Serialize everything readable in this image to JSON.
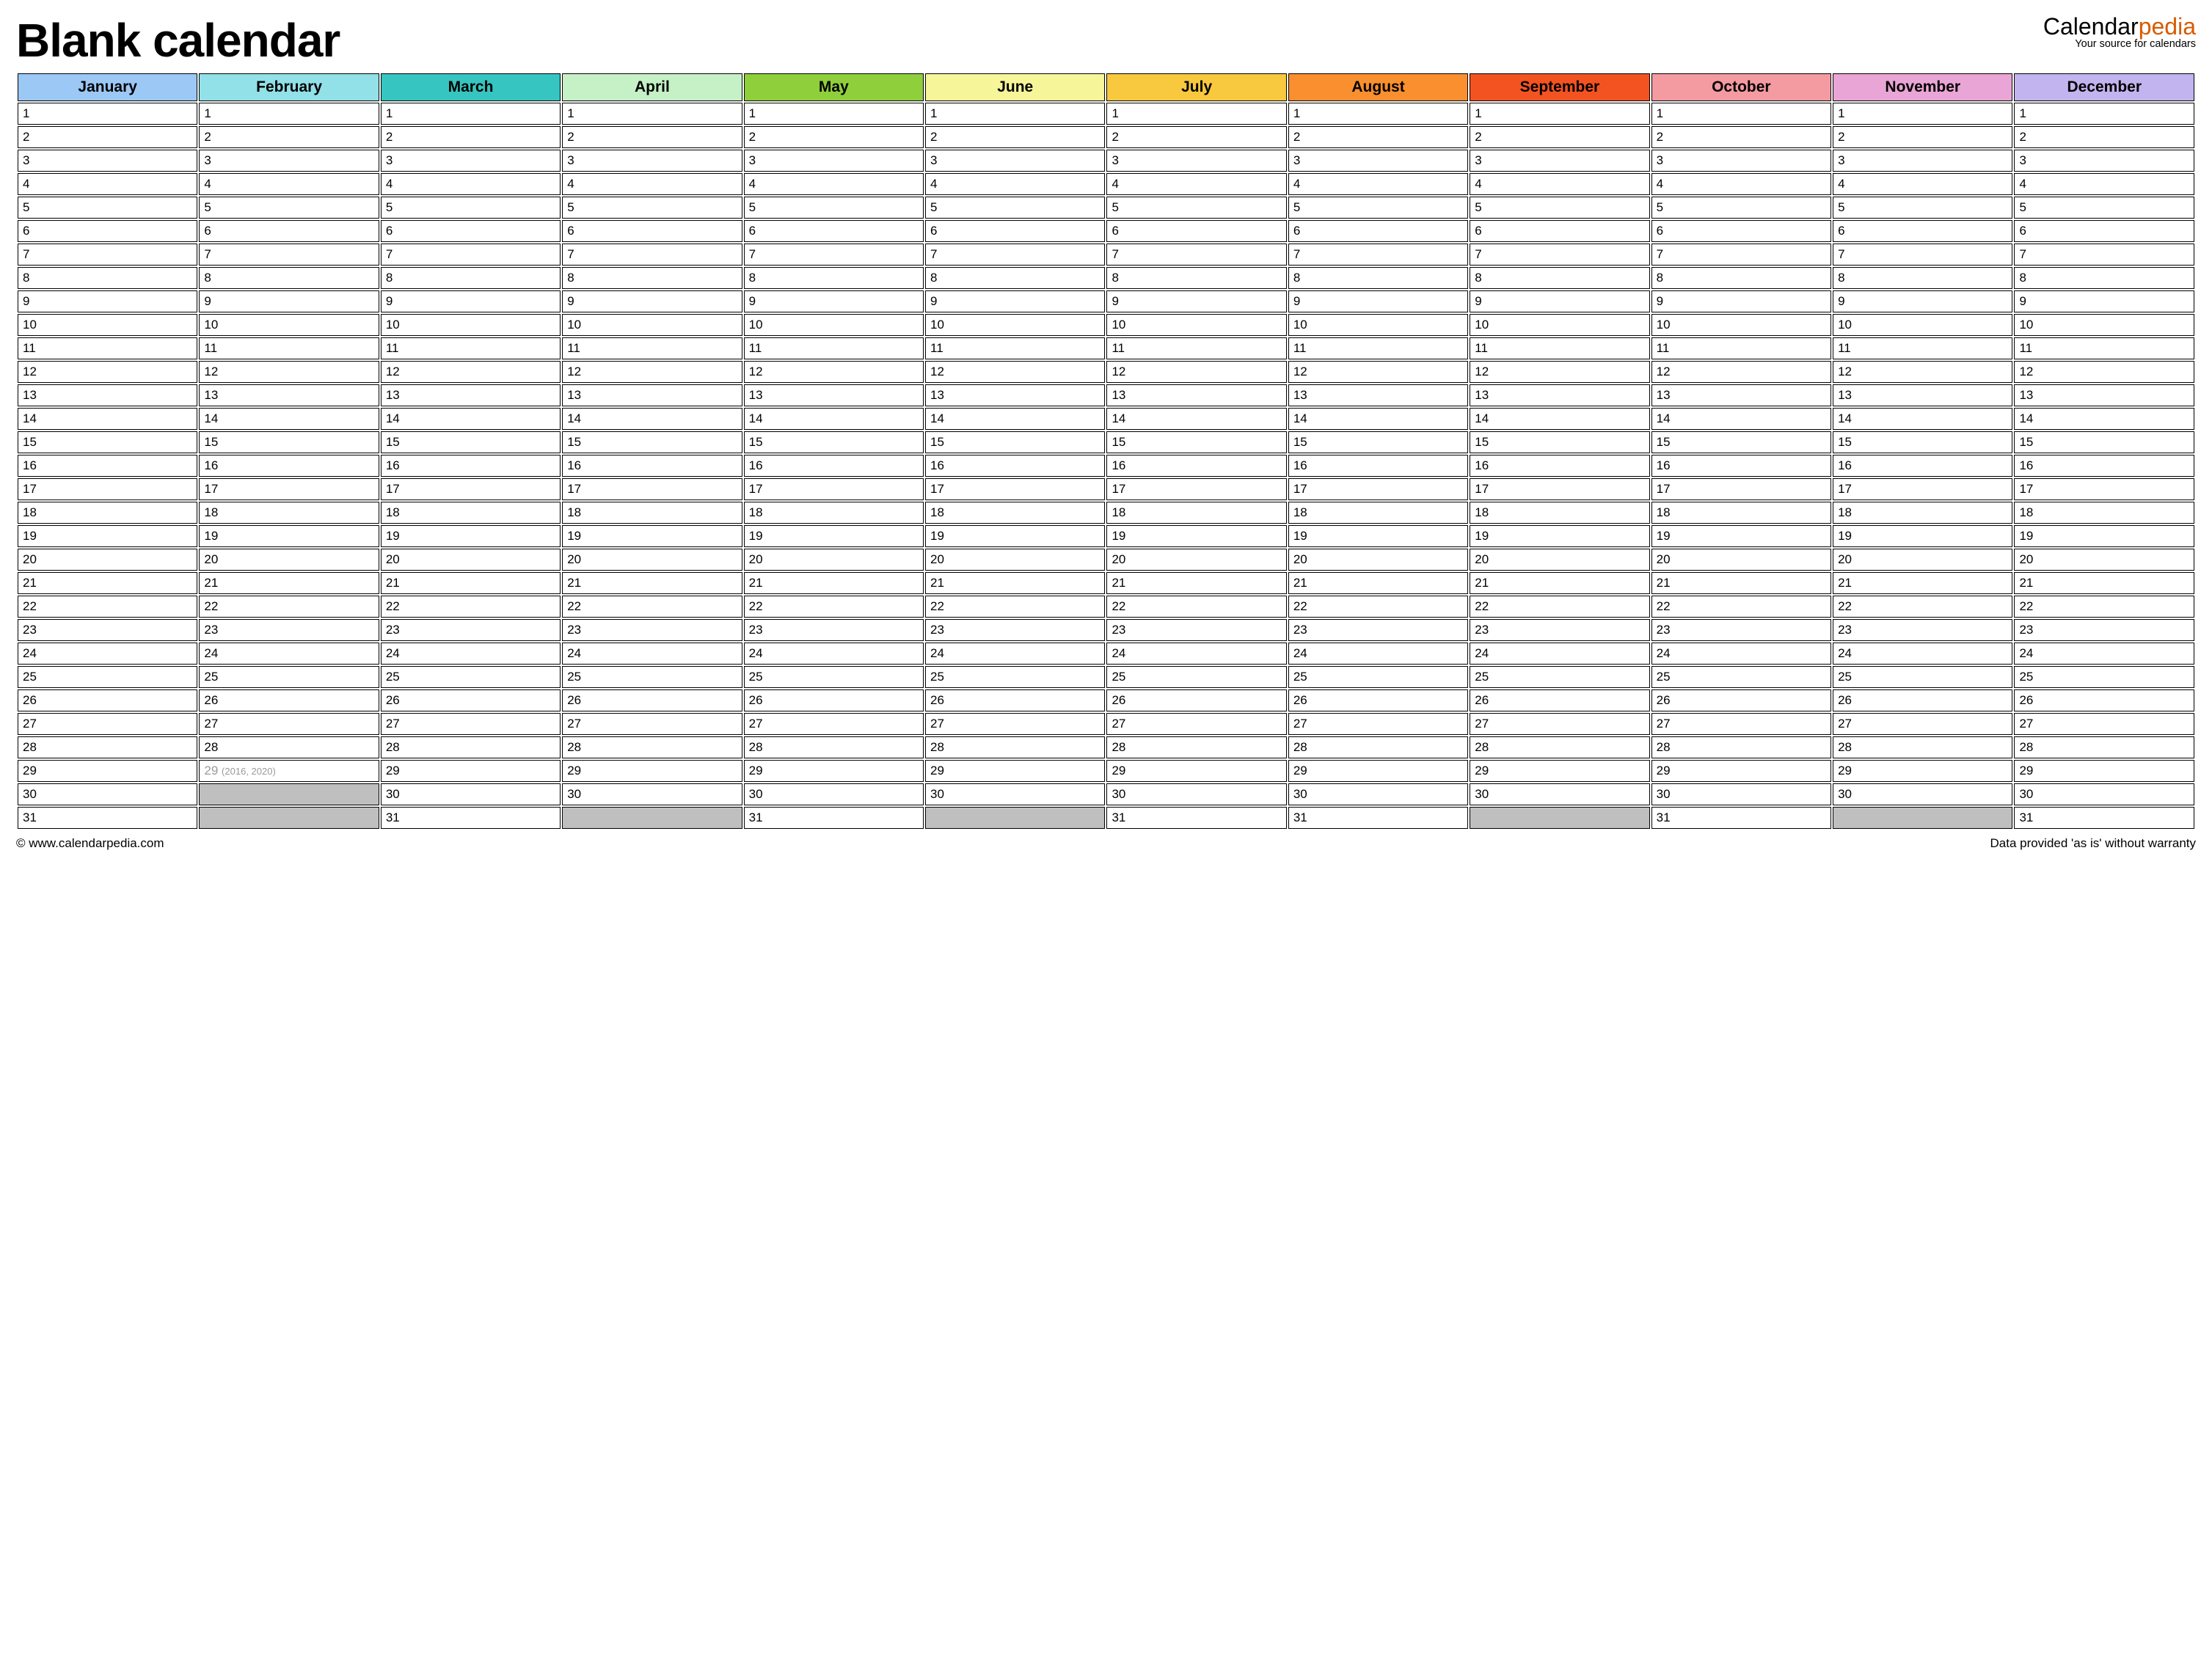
{
  "title": "Blank calendar",
  "logo": {
    "part1": "Calendar",
    "part2": "pedia",
    "tagline": "Your source for calendars"
  },
  "months": [
    {
      "name": "January",
      "color": "#9cc8f5",
      "days": 31
    },
    {
      "name": "February",
      "color": "#92e0e8",
      "days": 28,
      "leap": {
        "day": 29,
        "note": "(2016, 2020)"
      }
    },
    {
      "name": "March",
      "color": "#36c5c0",
      "days": 31
    },
    {
      "name": "April",
      "color": "#c6f0c5",
      "days": 30
    },
    {
      "name": "May",
      "color": "#8fcf3c",
      "days": 31
    },
    {
      "name": "June",
      "color": "#f6f59a",
      "days": 30
    },
    {
      "name": "July",
      "color": "#f8c93e",
      "days": 31
    },
    {
      "name": "August",
      "color": "#f98f2e",
      "days": 31
    },
    {
      "name": "September",
      "color": "#f35321",
      "days": 30
    },
    {
      "name": "October",
      "color": "#f49aa1",
      "days": 31
    },
    {
      "name": "November",
      "color": "#e9a5d5",
      "days": 30
    },
    {
      "name": "December",
      "color": "#c2b4ee",
      "days": 31
    }
  ],
  "maxRows": 31,
  "footer": {
    "left": "© www.calendarpedia.com",
    "right": "Data provided 'as is' without warranty"
  }
}
